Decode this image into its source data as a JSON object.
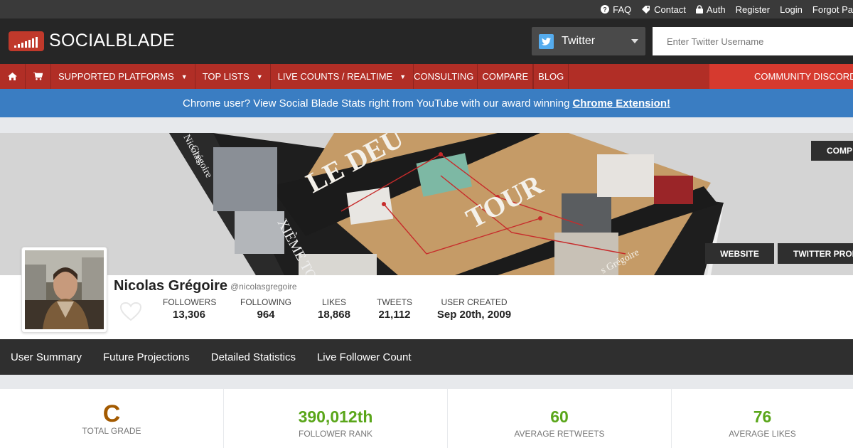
{
  "topbar": {
    "links": [
      {
        "icon": "question-circle-icon",
        "label": "FAQ"
      },
      {
        "icon": "tag-icon",
        "label": "Contact"
      },
      {
        "icon": "lock-icon",
        "label": "Auth"
      },
      {
        "icon": "",
        "label": "Register"
      },
      {
        "icon": "",
        "label": "Login"
      },
      {
        "icon": "",
        "label": "Forgot Pa"
      }
    ]
  },
  "header": {
    "logo_text": "SOCIALBLADE",
    "platform": "Twitter",
    "search_placeholder": "Enter Twitter Username"
  },
  "nav": {
    "items": [
      {
        "label": "SUPPORTED PLATFORMS",
        "dropdown": true
      },
      {
        "label": "TOP LISTS",
        "dropdown": true
      },
      {
        "label": "LIVE COUNTS / REALTIME",
        "dropdown": true
      },
      {
        "label": "CONSULTING",
        "dropdown": false
      },
      {
        "label": "COMPARE",
        "dropdown": false
      },
      {
        "label": "BLOG",
        "dropdown": false
      }
    ],
    "discord": "COMMUNITY DISCORD",
    "dropdown_glyph": "▼"
  },
  "banner": {
    "text": "Chrome user? View Social Blade Stats right from YouTube with our award winning",
    "link": "Chrome Extension!"
  },
  "cover": {
    "compare": "COMP",
    "website": "WEBSITE",
    "twitter_profile": "TWITTER PROF",
    "book_title_1": "LE DEU",
    "book_title_2": "TOUR",
    "book_spine": "XIÈME TOUR",
    "book_author": "Nicolas",
    "book_author_2": "Grégoire",
    "book_author_cover": "s Grégoire"
  },
  "profile": {
    "name": "Nicolas Grégoire",
    "handle": "@nicolasgregoire",
    "stats": [
      {
        "label": "FOLLOWERS",
        "value": "13,306"
      },
      {
        "label": "FOLLOWING",
        "value": "964"
      },
      {
        "label": "LIKES",
        "value": "18,868"
      },
      {
        "label": "TWEETS",
        "value": "21,112"
      },
      {
        "label": "USER CREATED",
        "value": "Sep 20th, 2009"
      }
    ]
  },
  "subnav": [
    "User Summary",
    "Future Projections",
    "Detailed Statistics",
    "Live Follower Count"
  ],
  "cards": [
    {
      "value": "C",
      "label": "TOTAL GRADE"
    },
    {
      "value": "390,012th",
      "label": "FOLLOWER RANK"
    },
    {
      "value": "60",
      "label": "AVERAGE RETWEETS"
    },
    {
      "value": "76",
      "label": "AVERAGE LIKES"
    }
  ],
  "colors": {
    "accent_red": "#b12e26",
    "banner_blue": "#3a7dc2",
    "grade_brown": "#a35a00",
    "stat_green": "#5aa61a",
    "twitter_blue": "#55acee"
  }
}
